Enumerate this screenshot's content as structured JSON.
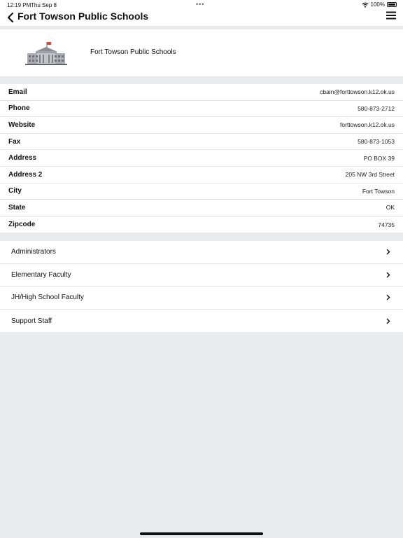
{
  "status_bar": {
    "time": "12:19 PM",
    "date": "Thu Sep 8",
    "dots": "•••",
    "battery": "100%"
  },
  "nav": {
    "title": "Fort Towson Public Schools"
  },
  "header": {
    "school_name": "Fort Towson Public Schools"
  },
  "info": [
    {
      "label": "Email",
      "value": "cbain@forttowson.k12.ok.us"
    },
    {
      "label": "Phone",
      "value": "580-873-2712"
    },
    {
      "label": "Website",
      "value": "forttowson.k12.ok.us"
    },
    {
      "label": "Fax",
      "value": "580-873-1053"
    },
    {
      "label": "Address",
      "value": "PO BOX 39"
    },
    {
      "label": "Address 2",
      "value": "205 NW 3rd Street"
    },
    {
      "label": "City",
      "value": "Fort Towson"
    },
    {
      "label": "State",
      "value": "OK"
    },
    {
      "label": "Zipcode",
      "value": "74735"
    }
  ],
  "links": [
    {
      "label": "Administrators"
    },
    {
      "label": "Elementary Faculty"
    },
    {
      "label": "JH/High School Faculty"
    },
    {
      "label": "Support Staff"
    }
  ],
  "colors": {
    "background": "#e9eaec",
    "card": "#ffffff",
    "flag": "#e0493a"
  }
}
